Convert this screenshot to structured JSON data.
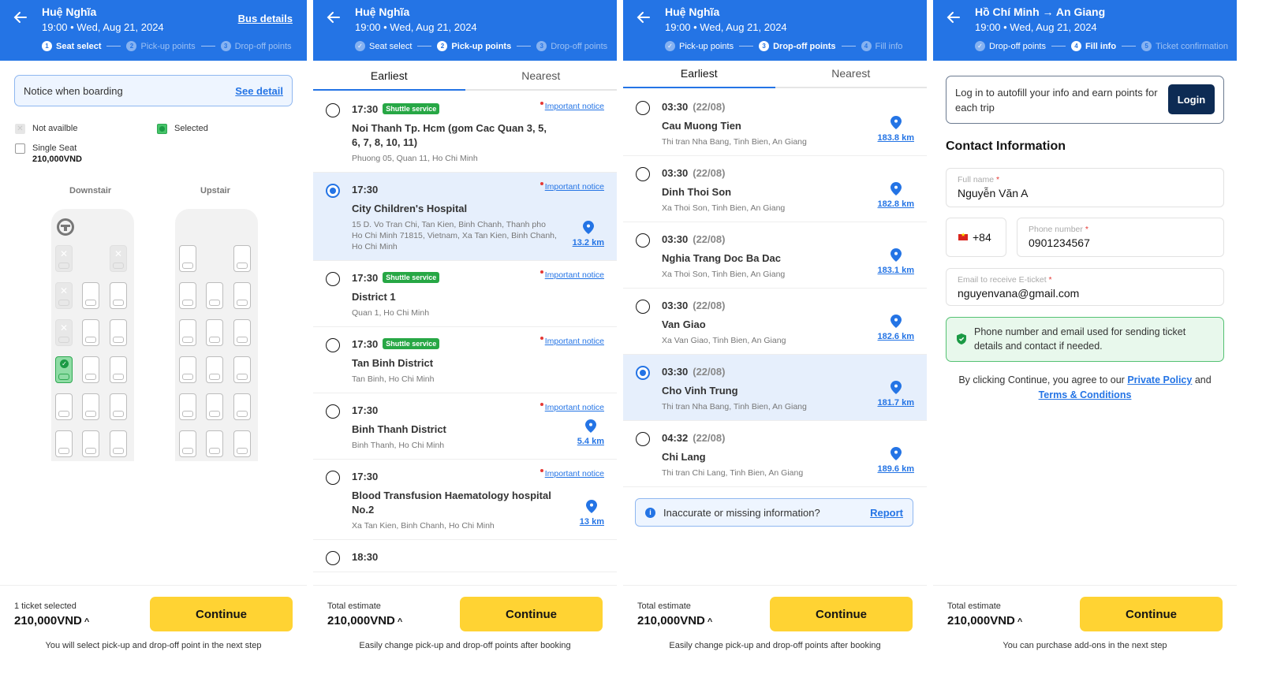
{
  "colors": {
    "brand_blue": "#2474e5",
    "continue_yellow": "#ffd333",
    "shuttle_green": "#27a745",
    "login_navy": "#0d2b54"
  },
  "panels": [
    {
      "header": {
        "title": "Huệ Nghĩa",
        "subtitle": "19:00 • Wed, Aug 21, 2024",
        "bus_details_link": "Bus details",
        "steps": [
          {
            "num": "1",
            "label": "Seat select",
            "state": "active"
          },
          {
            "num": "2",
            "label": "Pick-up points",
            "state": "upcoming"
          },
          {
            "num": "3",
            "label": "Drop-off points",
            "state": "upcoming"
          }
        ]
      },
      "notice": {
        "text": "Notice when boarding",
        "link": "See detail"
      },
      "legend": {
        "not_available": "Not availble",
        "selected": "Selected",
        "single_seat": "Single Seat",
        "single_seat_price": "210,000VND"
      },
      "decks": {
        "downstair_label": "Downstair",
        "upstair_label": "Upstair",
        "downstair_rows": [
          [
            "na",
            null,
            "na"
          ],
          [
            "na",
            "free",
            "free"
          ],
          [
            "na",
            "free",
            "free"
          ],
          [
            "selected",
            "free",
            "free"
          ],
          [
            "free",
            "free",
            "free"
          ],
          [
            "free",
            "free",
            "free"
          ]
        ],
        "upstair_rows": [
          [
            "free",
            null,
            "free"
          ],
          [
            "free",
            "free",
            "free"
          ],
          [
            "free",
            "free",
            "free"
          ],
          [
            "free",
            "free",
            "free"
          ],
          [
            "free",
            "free",
            "free"
          ],
          [
            "free",
            "free",
            "free"
          ]
        ]
      },
      "footer": {
        "label": "1 ticket selected",
        "total": "210,000VND",
        "continue": "Continue",
        "hint": "You will select pick-up and drop-off point in the next step"
      }
    },
    {
      "header": {
        "title": "Huệ Nghĩa",
        "subtitle": "19:00 • Wed, Aug 21, 2024",
        "steps": [
          {
            "num": "✓",
            "label": "Seat select",
            "state": "done"
          },
          {
            "num": "2",
            "label": "Pick-up points",
            "state": "active"
          },
          {
            "num": "3",
            "label": "Drop-off points",
            "state": "upcoming"
          }
        ]
      },
      "tabs": [
        "Earliest",
        "Nearest"
      ],
      "important_notice": "Important notice",
      "shuttle_label": "Shuttle service",
      "items": [
        {
          "time": "17:30",
          "shuttle": true,
          "name": "Noi Thanh Tp. Hcm (gom Cac Quan 3, 5, 6, 7, 8, 10, 11)",
          "address": "Phuong 05, Quan 11, Ho Chi Minh",
          "distance": null,
          "selected": false
        },
        {
          "time": "17:30",
          "shuttle": false,
          "name": "City Children's Hospital",
          "address": "15 D. Vo Tran Chi, Tan Kien, Binh Chanh, Thanh pho Ho Chi Minh 71815, Vietnam, Xa Tan Kien, Binh Chanh, Ho Chi Minh",
          "distance": "13.2 km",
          "selected": true
        },
        {
          "time": "17:30",
          "shuttle": true,
          "name": "District 1",
          "address": "Quan 1, Ho Chi Minh",
          "distance": null,
          "selected": false
        },
        {
          "time": "17:30",
          "shuttle": true,
          "name": "Tan Binh District",
          "address": "Tan Binh, Ho Chi Minh",
          "distance": null,
          "selected": false
        },
        {
          "time": "17:30",
          "shuttle": false,
          "name": "Binh Thanh District",
          "address": "Binh Thanh, Ho Chi Minh",
          "distance": "5.4 km",
          "selected": false
        },
        {
          "time": "17:30",
          "shuttle": false,
          "name": "Blood Transfusion Haematology hospital No.2",
          "address": "Xa Tan Kien, Binh Chanh, Ho Chi Minh",
          "distance": "13 km",
          "selected": false
        },
        {
          "time": "18:30",
          "shuttle": false,
          "name": "",
          "address": "",
          "distance": null,
          "selected": false
        }
      ],
      "footer": {
        "label": "Total estimate",
        "total": "210,000VND",
        "continue": "Continue",
        "hint": "Easily change pick-up and drop-off points after booking"
      }
    },
    {
      "header": {
        "title": "Huệ Nghĩa",
        "subtitle": "19:00 • Wed, Aug 21, 2024",
        "steps": [
          {
            "num": "✓",
            "label": "Pick-up points",
            "state": "done"
          },
          {
            "num": "3",
            "label": "Drop-off points",
            "state": "active"
          },
          {
            "num": "4",
            "label": "Fill info",
            "state": "upcoming"
          }
        ]
      },
      "tabs": [
        "Earliest",
        "Nearest"
      ],
      "items": [
        {
          "time": "03:30",
          "date": "(22/08)",
          "name": "Cau Muong Tien",
          "address": "Thi tran Nha Bang, Tinh Bien, An Giang",
          "distance": "183.8 km",
          "selected": false
        },
        {
          "time": "03:30",
          "date": "(22/08)",
          "name": "Dinh Thoi Son",
          "address": "Xa Thoi Son, Tinh Bien, An Giang",
          "distance": "182.8 km",
          "selected": false
        },
        {
          "time": "03:30",
          "date": "(22/08)",
          "name": "Nghia Trang Doc Ba Dac",
          "address": "Xa Thoi Son, Tinh Bien, An Giang",
          "distance": "183.1 km",
          "selected": false
        },
        {
          "time": "03:30",
          "date": "(22/08)",
          "name": "Van Giao",
          "address": "Xa Van Giao, Tinh Bien, An Giang",
          "distance": "182.6 km",
          "selected": false
        },
        {
          "time": "03:30",
          "date": "(22/08)",
          "name": "Cho Vinh Trung",
          "address": "Thi tran Nha Bang, Tinh Bien, An Giang",
          "distance": "181.7 km",
          "selected": true
        },
        {
          "time": "04:32",
          "date": "(22/08)",
          "name": "Chi Lang",
          "address": "Thi tran Chi Lang, Tinh Bien, An Giang",
          "distance": "189.6 km",
          "selected": false
        }
      ],
      "report": {
        "text": "Inaccurate or missing information?",
        "link": "Report"
      },
      "footer": {
        "label": "Total estimate",
        "total": "210,000VND",
        "continue": "Continue",
        "hint": "Easily change pick-up and drop-off points after booking"
      }
    },
    {
      "header": {
        "title": "Hồ Chí Minh → An Giang",
        "subtitle": "19:00 • Wed, Aug 21, 2024",
        "steps": [
          {
            "num": "✓",
            "label": "Drop-off points",
            "state": "done"
          },
          {
            "num": "4",
            "label": "Fill info",
            "state": "active"
          },
          {
            "num": "5",
            "label": "Ticket confirmation",
            "state": "upcoming"
          }
        ]
      },
      "login": {
        "text": "Log in to autofill your info and earn points for each trip",
        "button": "Login"
      },
      "contact": {
        "title": "Contact Information",
        "full_name_label": "Full name",
        "full_name_value": "Nguyễn Văn A",
        "country_code": "+84",
        "phone_label": "Phone number",
        "phone_value": "0901234567",
        "email_label": "Email to receive E-ticket",
        "email_value": "nguyenvana@gmail.com",
        "required_mark": "*"
      },
      "note": "Phone number and email used for sending ticket details and contact if needed.",
      "agree": {
        "prefix": "By clicking Continue, you agree to our",
        "privacy": "Private Policy",
        "and": "and",
        "terms": "Terms & Conditions"
      },
      "footer": {
        "label": "Total estimate",
        "total": "210,000VND",
        "continue": "Continue",
        "hint": "You can purchase add-ons in the next step"
      }
    }
  ]
}
